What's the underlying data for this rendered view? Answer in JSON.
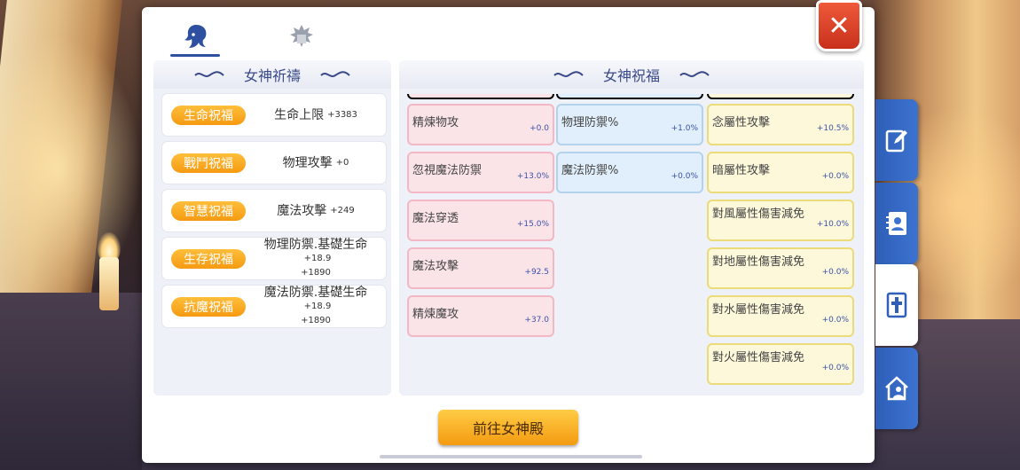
{
  "top_tabs": [
    {
      "icon": "goddess-head-icon",
      "active": true
    },
    {
      "icon": "emblem-icon",
      "active": false
    }
  ],
  "close_label": "✕",
  "left_section": {
    "title": "女神祈禱",
    "blessings": [
      {
        "tag": "生命祝福",
        "stat": "生命上限",
        "bonus": "+3383",
        "bonus2": ""
      },
      {
        "tag": "戰鬥祝福",
        "stat": "物理攻擊",
        "bonus": "+0",
        "bonus2": ""
      },
      {
        "tag": "智慧祝福",
        "stat": "魔法攻擊",
        "bonus": "+249",
        "bonus2": ""
      },
      {
        "tag": "生存祝福",
        "stat": "物理防禦.基礎生命",
        "bonus": "+18.9",
        "bonus2": "+1890"
      },
      {
        "tag": "抗魔祝福",
        "stat": "魔法防禦.基礎生命",
        "bonus": "+18.9",
        "bonus2": "+1890"
      }
    ]
  },
  "right_section": {
    "title": "女神祝福",
    "pink_cards": [
      {
        "name": "精煉物攻",
        "value": "+0.0"
      },
      {
        "name": "忽視魔法防禦",
        "value": "+13.0%"
      },
      {
        "name": "魔法穿透",
        "value": "+15.0%"
      },
      {
        "name": "魔法攻擊",
        "value": "+92.5"
      },
      {
        "name": "精煉魔攻",
        "value": "+37.0"
      }
    ],
    "blue_cards": [
      {
        "name": "物理防禦%",
        "value": "+1.0%"
      },
      {
        "name": "魔法防禦%",
        "value": "+0.0%"
      }
    ],
    "yellow_cards": [
      {
        "name": "念屬性攻擊",
        "value": "+10.5%"
      },
      {
        "name": "暗屬性攻擊",
        "value": "+0.0%"
      },
      {
        "name": "對風屬性傷害減免",
        "value": "+10.0%"
      },
      {
        "name": "對地屬性傷害減免",
        "value": "+0.0%"
      },
      {
        "name": "對水屬性傷害減免",
        "value": "+0.0%"
      },
      {
        "name": "對火屬性傷害減免",
        "value": "+0.0%"
      }
    ]
  },
  "go_button_label": "前往女神殿",
  "side_tabs": [
    {
      "icon": "edit-icon",
      "active": false
    },
    {
      "icon": "contact-book-icon",
      "active": false
    },
    {
      "icon": "cross-book-icon",
      "active": true
    },
    {
      "icon": "home-person-icon",
      "active": false
    }
  ],
  "colors": {
    "accent_blue": "#3a4a88",
    "tag_orange": "#f59a12",
    "close_red": "#d63a22",
    "side_tab_blue": "#3c72d0"
  }
}
